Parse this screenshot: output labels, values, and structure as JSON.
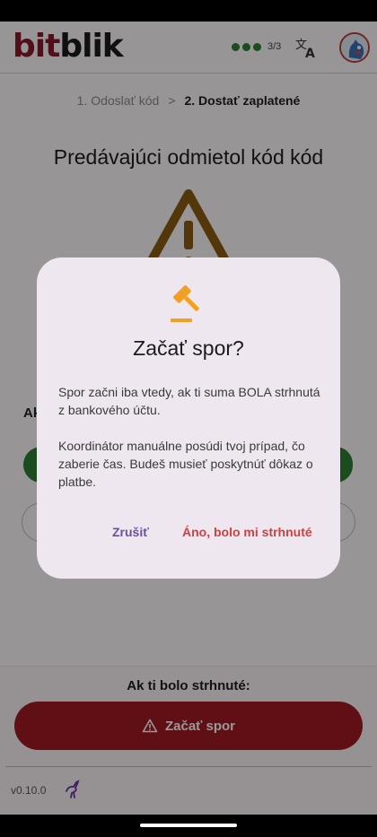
{
  "app": {
    "logo_bit": "bit",
    "logo_blik": "blik",
    "progress_text": "3/3",
    "colors": {
      "brand": "#8b1a2b",
      "accent_green": "#2e7d32",
      "danger": "#a01a23"
    }
  },
  "breadcrumb": {
    "step1": "1. Odoslať kód",
    "separator": ">",
    "step2": "2. Dostať zaplatené"
  },
  "page": {
    "title": "Predávajúci odmietol kód kód",
    "behind_label": "Ak"
  },
  "bottom": {
    "label": "Ak ti bolo strhnuté:",
    "dispute_button": "Začať spor",
    "version": "v0.10.0"
  },
  "dialog": {
    "title": "Začať spor?",
    "paragraph1": "Spor začni iba vtedy, ak ti suma BOLA strhnutá z bankového účtu.",
    "paragraph2": "Koordinátor manuálne posúdi tvoj prípad, čo zaberie čas. Budeš musieť poskytnúť dôkaz o platbe.",
    "cancel_label": "Zrušiť",
    "confirm_label": "Áno, bolo mi strhnuté"
  }
}
